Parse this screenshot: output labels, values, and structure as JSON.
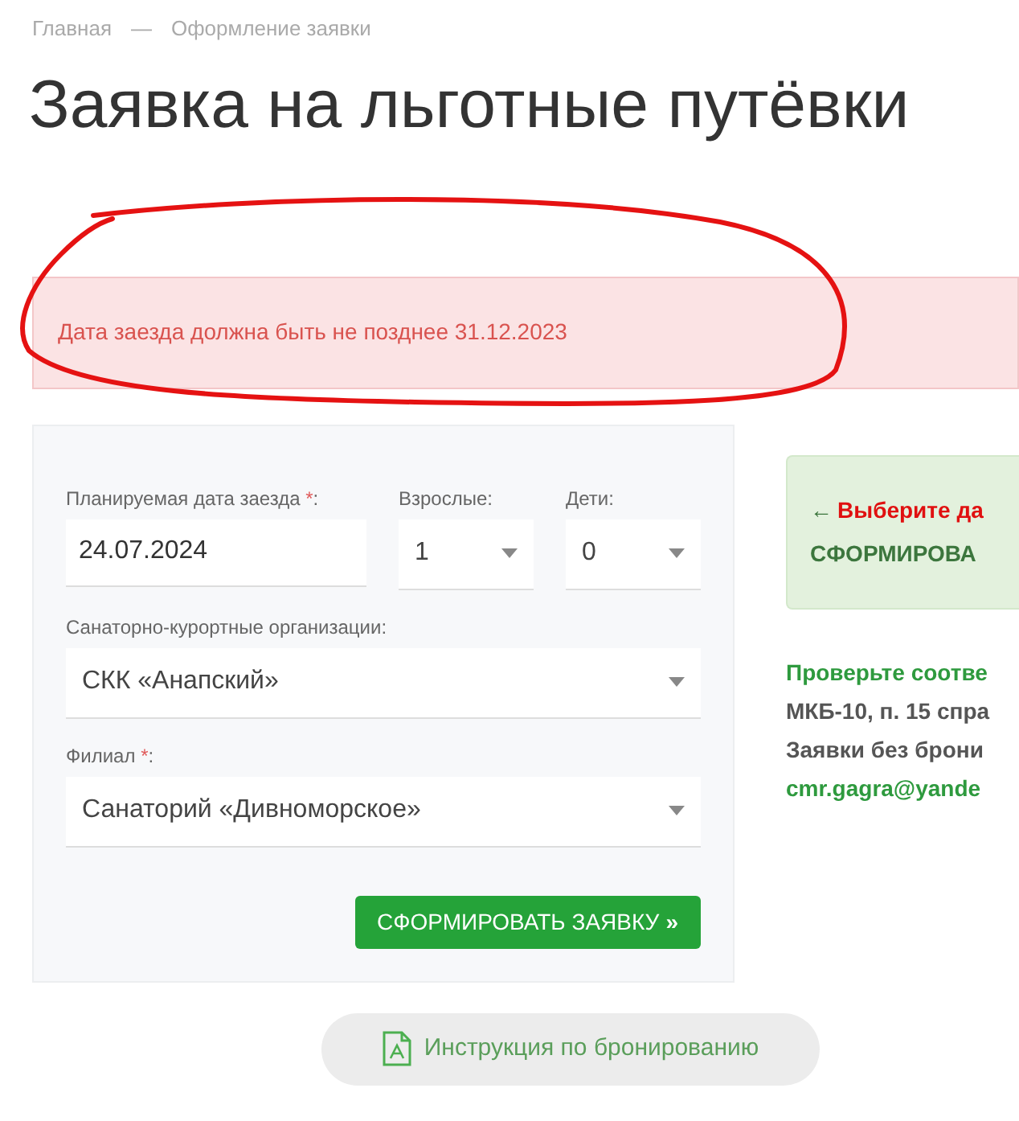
{
  "breadcrumb": {
    "items": [
      {
        "label": "Главная"
      },
      {
        "label": "Оформление заявки"
      }
    ],
    "separator": "—"
  },
  "title": "Заявка на льготные путёвки",
  "alert": {
    "message": "Дата заезда должна быть не позднее 31.12.2023"
  },
  "form": {
    "rows": [
      [
        {
          "label": "Планируемая дата заезда",
          "required_mark": "*",
          "label_end": ":",
          "kind": "input",
          "value": "24.07.2024"
        },
        {
          "label": "Взрослые:",
          "kind": "select",
          "value": "1"
        },
        {
          "label": "Дети:",
          "kind": "select",
          "value": "0"
        }
      ],
      [
        {
          "label": "Санаторно-курортные организации:",
          "kind": "select",
          "value": "СКК «Анапский»"
        }
      ],
      [
        {
          "label": "Филиал",
          "required_mark": "*",
          "label_end": ":",
          "kind": "select",
          "value": "Санаторий «Дивноморское»"
        }
      ]
    ],
    "submit_button": {
      "label": "СФОРМИРОВАТЬ ЗАЯВКУ",
      "icon": "»"
    }
  },
  "instruction_button": {
    "label": "Инструкция по бронированию"
  },
  "notice": {
    "arrow": "←",
    "highlight": "Выберите да",
    "line_2": "СФОРМИРОВА"
  },
  "info_lines": [
    {
      "text": "Проверьте соотве",
      "color": "#2e9a3e"
    },
    {
      "text": "МКБ-10, п. 15 спра",
      "color": "#555555"
    },
    {
      "text": "Заявки без брони",
      "color": "#555555"
    },
    {
      "text": "cmr.gagra@yande",
      "color": "#2e9a3e"
    }
  ]
}
